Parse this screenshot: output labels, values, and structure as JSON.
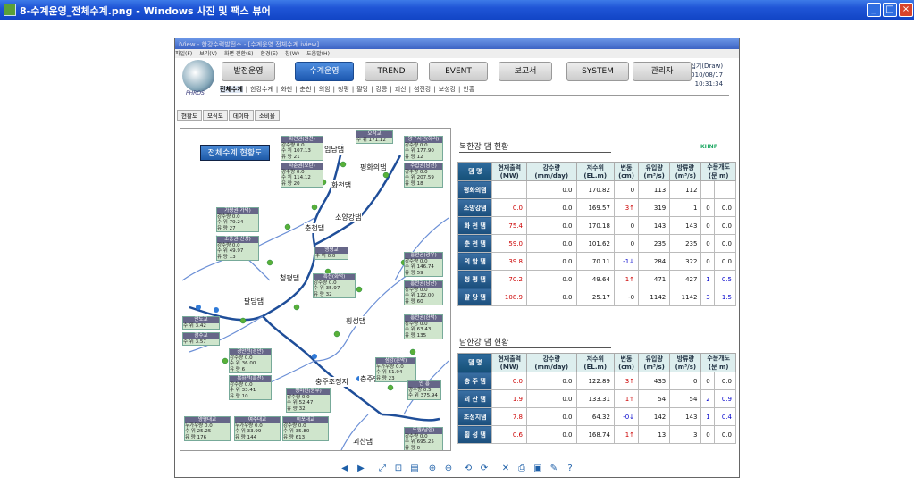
{
  "window": {
    "title": "8-수계운영_전체수계.png - Windows 사진 및 팩스 뷰어"
  },
  "inner": {
    "title": "iView - 한강수력발전소 - [수계운영 전체수계.iview]",
    "menu": [
      "파일(F)",
      "보기(V)",
      "화면 전환(S)",
      "환경(E)",
      "창(W)",
      "도움말(H)"
    ],
    "editor": "편집기(Draw)",
    "date": "2010/08/17",
    "time": "10:31:34",
    "logo_text": "PHROS"
  },
  "main_tabs": [
    "발전운영",
    "수계운영",
    "TREND",
    "EVENT",
    "보고서",
    "SYSTEM",
    "관리자"
  ],
  "subnav": [
    "전체수계",
    "한강수계",
    "화천",
    "춘천",
    "의암",
    "청평",
    "팔당",
    "강릉",
    "괴산",
    "섬진강",
    "보성강",
    "안흥"
  ],
  "view_tabs": [
    "현황도",
    "모식도",
    "데이타",
    "소비율"
  ],
  "map": {
    "title": "전체수계 현황도",
    "dams": [
      "평화의댐",
      "화천댐",
      "소양강댐",
      "춘천댐",
      "의암댐",
      "청평댐",
      "팔당댐",
      "횡성댐",
      "충주조정지",
      "충주댐",
      "괴산댐",
      "임남댐"
    ]
  },
  "stations": [
    {
      "name": "오작교",
      "rows": [
        "수 위  171.12"
      ]
    },
    {
      "name": "화천권(원천)",
      "rows": [
        "강수량  0.0",
        "수 위  107.13",
        "유 량  21"
      ]
    },
    {
      "name": "양구서천(하리)",
      "rows": [
        "강수량  0.0",
        "수 위  177.90",
        "유 량  12"
      ]
    },
    {
      "name": "자춘권(오탄)",
      "rows": [
        "강수량  0.0",
        "수 위  114.12",
        "유 량  20"
      ]
    },
    {
      "name": "수입권(남전)",
      "rows": [
        "강수량  0.0",
        "수 위  207.59",
        "유 량  18"
      ]
    },
    {
      "name": "가평권(가덕)",
      "rows": [
        "강수량  0.0",
        "수 위  79.24",
        "유 량  27"
      ]
    },
    {
      "name": "조종권(신상)",
      "rows": [
        "강수량  0.0",
        "수 위  49.97",
        "유 량  13"
      ]
    },
    {
      "name": "영평교",
      "rows": [
        "수 위  0.0"
      ]
    },
    {
      "name": "홍천권(광우)",
      "rows": [
        "강수량  0.0",
        "수 위  146.74",
        "유 량  59"
      ]
    },
    {
      "name": "홍천권(남산)",
      "rows": [
        "강수량  0.0",
        "수 위  122.00",
        "유 량  60"
      ]
    },
    {
      "name": "흑천(화덕)",
      "rows": [
        "강수량  0.0",
        "수 위  35.97",
        "유 량  32"
      ]
    },
    {
      "name": "안도교",
      "rows": [
        "수 위  3.42"
      ]
    },
    {
      "name": "잠수교",
      "rows": [
        "수 위  3.57"
      ]
    },
    {
      "name": "홍천권(한덕)",
      "rows": [
        "강수량  0.0",
        "수 위  63.43",
        "유 량  135"
      ]
    },
    {
      "name": "경안천(경안)",
      "rows": [
        "강수량  0.0",
        "수 위  36.00",
        "유 량  6"
      ]
    },
    {
      "name": "복하천(흥천)",
      "rows": [
        "강수량  0.0",
        "수 위  33.41",
        "유 량  10"
      ]
    },
    {
      "name": "섬강(문막)",
      "rows": [
        "누가우량  0.0",
        "수 위  51.94",
        "유 량  23"
      ]
    },
    {
      "name": "청미천(원부)",
      "rows": [
        "강수량  0.0",
        "수 위  52.47",
        "유 량  32"
      ]
    },
    {
      "name": "안 흥",
      "rows": [
        "강수량  0.5",
        "수 위  375.94"
      ]
    },
    {
      "name": "양평대교",
      "rows": [
        "누가우량  0.0",
        "수 위  25.25",
        "유 량  176"
      ]
    },
    {
      "name": "여주대교",
      "rows": [
        "누가우량  0.0",
        "수 위  33.99",
        "유 량  144"
      ]
    },
    {
      "name": "이포대교",
      "rows": [
        "강수량  0.0",
        "수 위  35.80",
        "유 량  613"
      ]
    },
    {
      "name": "도원(남한)",
      "rows": [
        "강수량  0.0",
        "수 위  695.25",
        "유 량  0"
      ]
    }
  ],
  "north": {
    "title": "북한강 댐 현황",
    "headers": [
      "댐 명",
      "현재출력",
      "강수량",
      "저수위",
      "변동",
      "유입량",
      "방류량",
      "수문개도"
    ],
    "units": [
      "",
      "(MW)",
      "(mm/day)",
      "(EL.m)",
      "(cm)",
      "(m³/s)",
      "(m³/s)",
      "(문 m)"
    ],
    "rows": [
      [
        "평화의댐",
        "",
        "0.0",
        "170.82",
        "0",
        "113",
        "112",
        "",
        ""
      ],
      [
        "소양강댐",
        "0.0",
        "0.0",
        "169.57",
        "3↑",
        "319",
        "1",
        "0",
        "0.0"
      ],
      [
        "화 천 댐",
        "75.4",
        "0.0",
        "170.18",
        "0",
        "143",
        "143",
        "0",
        "0.0"
      ],
      [
        "춘 천 댐",
        "59.0",
        "0.0",
        "101.62",
        "0",
        "235",
        "235",
        "0",
        "0.0"
      ],
      [
        "의 암 댐",
        "39.8",
        "0.0",
        "70.11",
        "-1↓",
        "284",
        "322",
        "0",
        "0.0"
      ],
      [
        "청 평 댐",
        "70.2",
        "0.0",
        "49.64",
        "1↑",
        "471",
        "427",
        "1",
        "0.5"
      ],
      [
        "팔 당 댐",
        "108.9",
        "0.0",
        "25.17",
        "-0",
        "1142",
        "1142",
        "3",
        "1.5"
      ]
    ]
  },
  "south": {
    "title": "남한강 댐 현황",
    "headers": [
      "댐 명",
      "현재출력",
      "강수량",
      "저수위",
      "변동",
      "유입량",
      "방류량",
      "수문개도"
    ],
    "units": [
      "",
      "(MW)",
      "(mm/day)",
      "(EL.m)",
      "(cm)",
      "(m³/s)",
      "(m³/s)",
      "(문 m)"
    ],
    "rows": [
      [
        "충 주 댐",
        "0.0",
        "0.0",
        "122.89",
        "3↑",
        "435",
        "0",
        "0",
        "0.0"
      ],
      [
        "괴 산 댐",
        "1.9",
        "0.0",
        "133.31",
        "1↑",
        "54",
        "54",
        "2",
        "0.9"
      ],
      [
        "조정지댐",
        "7.8",
        "0.0",
        "64.32",
        "-0↓",
        "142",
        "143",
        "1",
        "0.4"
      ],
      [
        "횡 성 댐",
        "0.6",
        "0.0",
        "168.74",
        "1↑",
        "13",
        "3",
        "0",
        "0.0"
      ]
    ]
  },
  "kepco": "KHNP",
  "toolbar_icons": [
    "prev-icon",
    "next-icon",
    "fit-icon",
    "actual-size-icon",
    "slideshow-icon",
    "zoom-in-icon",
    "zoom-out-icon",
    "rotate-left-icon",
    "rotate-right-icon",
    "delete-icon",
    "print-icon",
    "save-icon",
    "edit-icon",
    "help-icon"
  ]
}
